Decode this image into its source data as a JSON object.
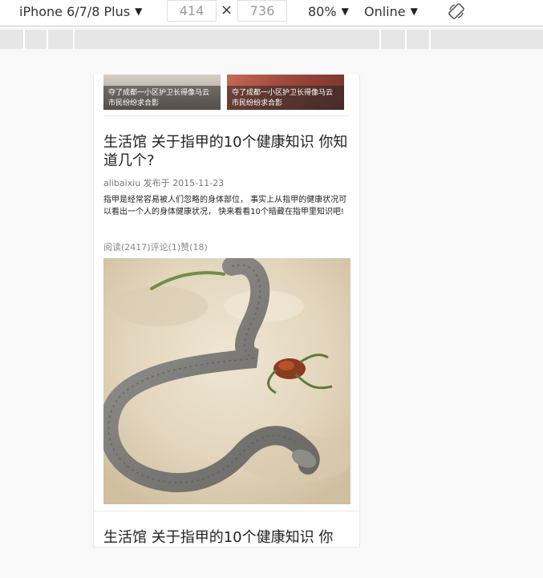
{
  "toolbar": {
    "device": "iPhone 6/7/8 Plus",
    "width": "414",
    "height": "736",
    "times": "×",
    "zoom": "80%",
    "network": "Online"
  },
  "thumbs": [
    {
      "caption": "夺了成都一小区护卫长得像马云 市民纷纷求合影"
    },
    {
      "caption": "夺了成都一小区护卫长得像马云 市民纷纷求合影"
    }
  ],
  "posts": [
    {
      "title": "生活馆 关于指甲的10个健康知识 你知道几个?",
      "meta": "alibaixiu 发布于 2015-11-23",
      "excerpt": "指甲是经常容易被人们忽略的身体部位， 事实上从指甲的健康状况可以看出一个人的身体健康状况， 快来看看10个暗藏在指甲里知识吧!",
      "stats": "阅读(2417)评论(1)赞(18)"
    },
    {
      "title": "生活馆 关于指甲的10个健康知识 你"
    }
  ],
  "colors": {
    "page_bg": "#f9f9f9",
    "mq_bar": "#e6e6e6",
    "text": "#222222",
    "muted": "#888888"
  }
}
